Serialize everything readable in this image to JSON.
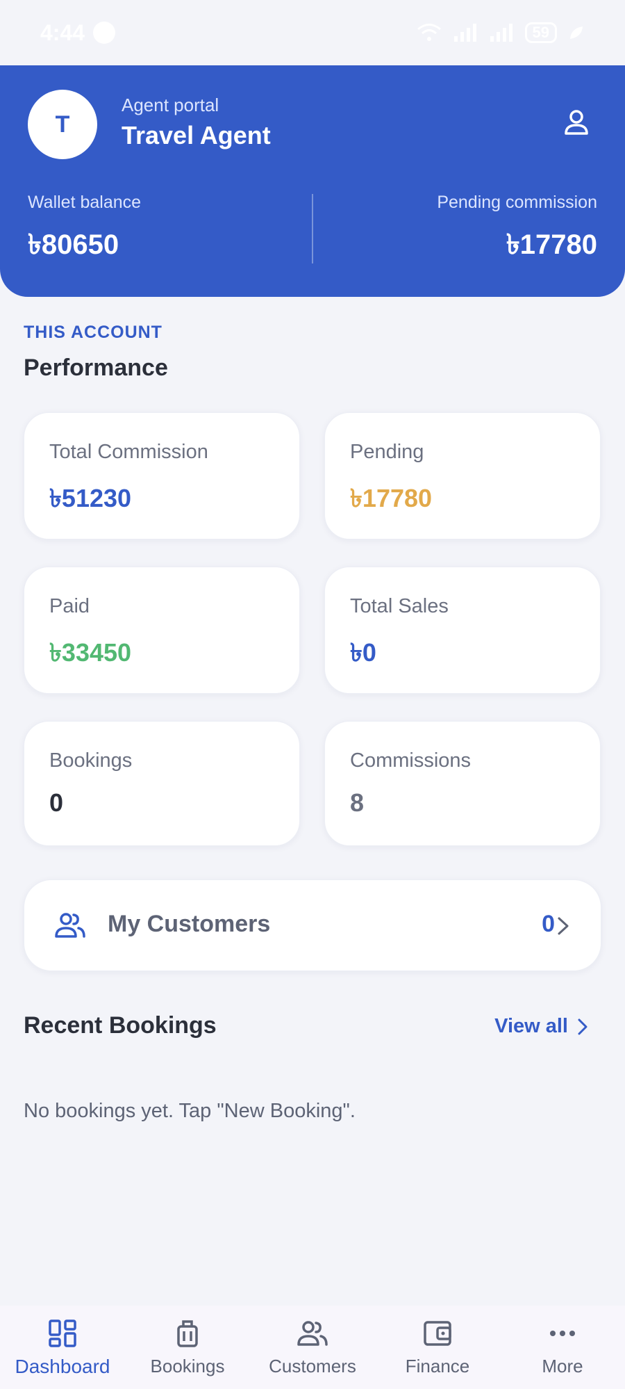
{
  "status_bar": {
    "time": "4:44",
    "battery": "59",
    "icons": [
      "facebook-icon",
      "wifi-icon",
      "signal-icon",
      "signal-icon",
      "battery-icon",
      "leaf-icon"
    ]
  },
  "header": {
    "avatar_initial": "T",
    "portal_label": "Agent portal",
    "agent_name": "Travel Agent",
    "profile_icon": "user-icon",
    "wallet_label": "Wallet balance",
    "wallet_value": "৳80650",
    "pending_label": "Pending commission",
    "pending_value": "৳17780"
  },
  "performance": {
    "eyebrow": "THIS ACCOUNT",
    "title": "Performance",
    "cards": [
      {
        "label": "Total Commission",
        "value": "৳51230",
        "color": "#345bc7"
      },
      {
        "label": "Pending",
        "value": "৳17780",
        "color": "#e2a94a"
      },
      {
        "label": "Paid",
        "value": "৳33450",
        "color": "#52b872"
      },
      {
        "label": "Total Sales",
        "value": "৳0",
        "color": "#345bc7"
      },
      {
        "label": "Bookings",
        "value": "0",
        "color": "#2b2f3a"
      },
      {
        "label": "Commissions",
        "value": "8",
        "color": "#6b7080"
      }
    ]
  },
  "customers": {
    "label": "My Customers",
    "count": "0",
    "icon": "users-icon"
  },
  "recent_bookings": {
    "title": "Recent Bookings",
    "view_all": "View all",
    "empty_text": "No bookings yet. Tap \"New Booking\"."
  },
  "bottom_nav": {
    "items": [
      {
        "label": "Dashboard",
        "icon": "dashboard-icon",
        "active": true
      },
      {
        "label": "Bookings",
        "icon": "luggage-icon",
        "active": false
      },
      {
        "label": "Customers",
        "icon": "users-icon",
        "active": false
      },
      {
        "label": "Finance",
        "icon": "wallet-icon",
        "active": false
      },
      {
        "label": "More",
        "icon": "more-icon",
        "active": false
      }
    ]
  },
  "colors": {
    "primary": "#345bc7",
    "background": "#f3f4f9",
    "pending": "#e2a94a",
    "paid": "#52b872"
  }
}
